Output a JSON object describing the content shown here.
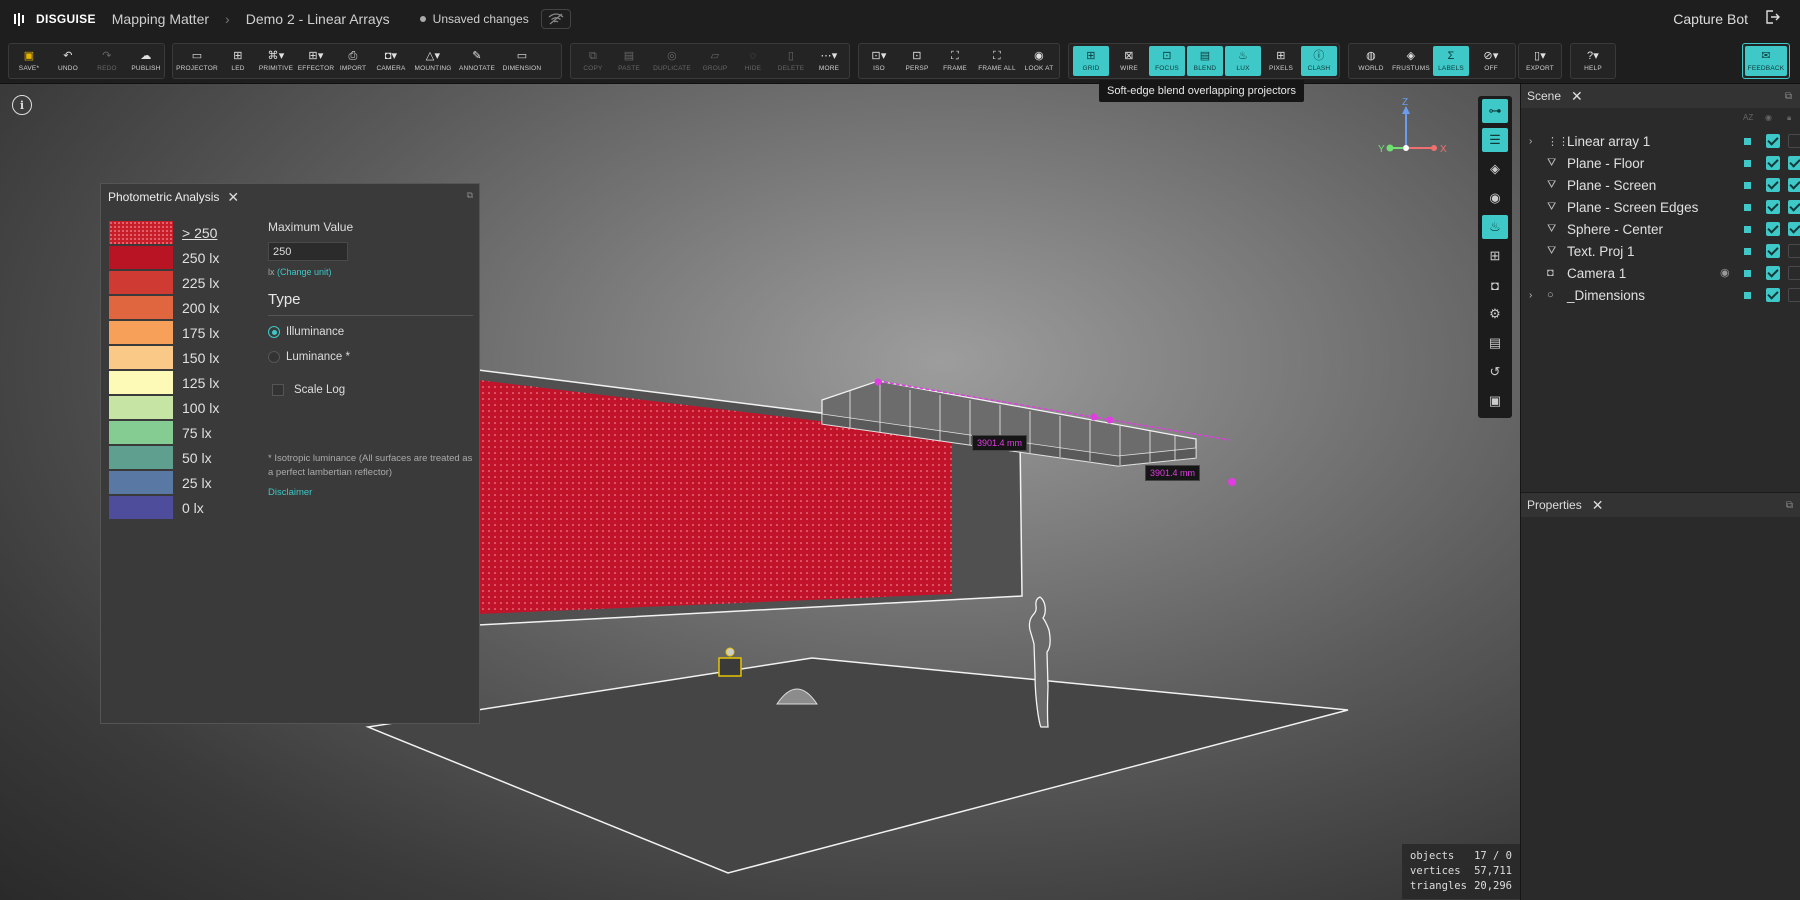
{
  "topbar": {
    "brand": "DISGUISE",
    "project": "Mapping Matter",
    "file": "Demo 2 - Linear Arrays",
    "status": "Unsaved changes",
    "user": "Capture Bot"
  },
  "toolbar": {
    "file_tools": [
      {
        "label": "SAVE*",
        "icon": "save-icon"
      },
      {
        "label": "UNDO",
        "icon": "undo-icon"
      },
      {
        "label": "REDO",
        "icon": "redo-icon",
        "disabled": true
      },
      {
        "label": "PUBLISH",
        "icon": "cloud-upload-icon"
      }
    ],
    "create_tools": [
      {
        "label": "PROJECTOR",
        "icon": "projector-icon"
      },
      {
        "label": "LED",
        "icon": "led-icon"
      },
      {
        "label": "PRIMITIVE",
        "icon": "primitive-icon"
      },
      {
        "label": "EFFECTOR",
        "icon": "effector-icon"
      },
      {
        "label": "IMPORT",
        "icon": "import-icon"
      },
      {
        "label": "CAMERA",
        "icon": "camera-icon"
      },
      {
        "label": "MOUNTING",
        "icon": "mounting-icon"
      },
      {
        "label": "ANNOTATE",
        "icon": "pen-icon"
      },
      {
        "label": "DIMENSION",
        "icon": "ruler-icon"
      }
    ],
    "edit_tools": [
      {
        "label": "COPY",
        "icon": "copy-icon"
      },
      {
        "label": "PASTE",
        "icon": "paste-icon"
      },
      {
        "label": "DUPLICATE",
        "icon": "duplicate-icon"
      },
      {
        "label": "GROUP",
        "icon": "folder-icon"
      },
      {
        "label": "HIDE",
        "icon": "eye-off-icon"
      },
      {
        "label": "DELETE",
        "icon": "trash-icon"
      },
      {
        "label": "MORE",
        "icon": "more-icon"
      }
    ],
    "view_tools": [
      {
        "label": "ISO",
        "icon": "iso-icon"
      },
      {
        "label": "PERSP",
        "icon": "persp-icon"
      },
      {
        "label": "FRAME",
        "icon": "frame-icon"
      },
      {
        "label": "FRAME ALL",
        "icon": "frame-all-icon"
      },
      {
        "label": "LOOK AT",
        "icon": "look-at-icon"
      }
    ],
    "display_tools": [
      {
        "label": "GRID",
        "icon": "grid-icon",
        "active": true
      },
      {
        "label": "WIRE",
        "icon": "wire-icon"
      },
      {
        "label": "FOCUS",
        "icon": "focus-icon",
        "active": true
      },
      {
        "label": "BLEND",
        "icon": "blend-icon",
        "active": true
      },
      {
        "label": "LUX",
        "icon": "lux-icon",
        "active": true
      },
      {
        "label": "PIXELS",
        "icon": "pixels-icon"
      },
      {
        "label": "CLASH",
        "icon": "clash-icon",
        "active": true
      }
    ],
    "world_tools": [
      {
        "label": "WORLD",
        "icon": "globe-icon"
      },
      {
        "label": "FRUSTUMS",
        "icon": "frustum-icon"
      },
      {
        "label": "LABELS",
        "icon": "labels-icon",
        "active": true
      },
      {
        "label": "OFF",
        "icon": "off-icon"
      }
    ],
    "export_label": "EXPORT",
    "help_label": "HELP",
    "feedback_label": "FEEDBACK",
    "tooltip": "Soft-edge blend overlapping projectors"
  },
  "viewport": {
    "axes": {
      "z": "Z",
      "y": "Y",
      "x": "X"
    },
    "dimension_labels": [
      "3901.4 mm",
      "3901.4 mm"
    ],
    "stats": [
      {
        "label": "objects",
        "value": "17 / 0"
      },
      {
        "label": "vertices",
        "value": "57,711"
      },
      {
        "label": "triangles",
        "value": "20,296"
      }
    ]
  },
  "photometric": {
    "title": "Photometric Analysis",
    "legend": [
      {
        "label": "> 250",
        "color": "#c81e2a"
      },
      {
        "label": "250 lx",
        "color": "#b81424"
      },
      {
        "label": "225 lx",
        "color": "#cf3a33"
      },
      {
        "label": "200 lx",
        "color": "#e0663f"
      },
      {
        "label": "175 lx",
        "color": "#f6a05a"
      },
      {
        "label": "150 lx",
        "color": "#fbc987"
      },
      {
        "label": "125 lx",
        "color": "#fdf9b6"
      },
      {
        "label": "100 lx",
        "color": "#c6e4a4"
      },
      {
        "label": "75 lx",
        "color": "#84cc92"
      },
      {
        "label": "50 lx",
        "color": "#5f9f90"
      },
      {
        "label": "25 lx",
        "color": "#5a78a4"
      },
      {
        "label": "0 lx",
        "color": "#4d4d9c"
      }
    ],
    "max_value_label": "Maximum Value",
    "max_value": "250",
    "unit_prefix": "lx",
    "change_unit": "(Change unit)",
    "type_heading": "Type",
    "type_options": [
      {
        "label": "Illuminance",
        "selected": true
      },
      {
        "label": "Luminance *",
        "selected": false
      }
    ],
    "scale_log": "Scale Log",
    "note": "* Isotropic luminance (All surfaces are treated as a perfect lambertian reflector)",
    "disclaimer": "Disclaimer"
  },
  "scene": {
    "tab": "Scene",
    "items": [
      {
        "name": "Linear array 1",
        "icon": "array-icon",
        "expandable": true,
        "visible": true,
        "locked": false
      },
      {
        "name": "Plane - Floor",
        "icon": "plane-icon",
        "expandable": false,
        "visible": true,
        "locked": true
      },
      {
        "name": "Plane - Screen",
        "icon": "plane-icon",
        "expandable": false,
        "visible": true,
        "locked": true
      },
      {
        "name": "Plane - Screen Edges",
        "icon": "plane-icon",
        "expandable": false,
        "visible": true,
        "locked": true
      },
      {
        "name": "Sphere - Center",
        "icon": "sphere-icon",
        "expandable": false,
        "visible": true,
        "locked": true
      },
      {
        "name": "Text. Proj 1",
        "icon": "text-icon",
        "expandable": false,
        "visible": true,
        "locked": false
      },
      {
        "name": "Camera 1",
        "icon": "camera-icon",
        "expandable": false,
        "visible": true,
        "locked": false,
        "eye": true
      },
      {
        "name": "_Dimensions",
        "icon": "circle-icon",
        "expandable": true,
        "visible": true,
        "locked": false
      }
    ]
  },
  "properties": {
    "tab": "Properties"
  }
}
